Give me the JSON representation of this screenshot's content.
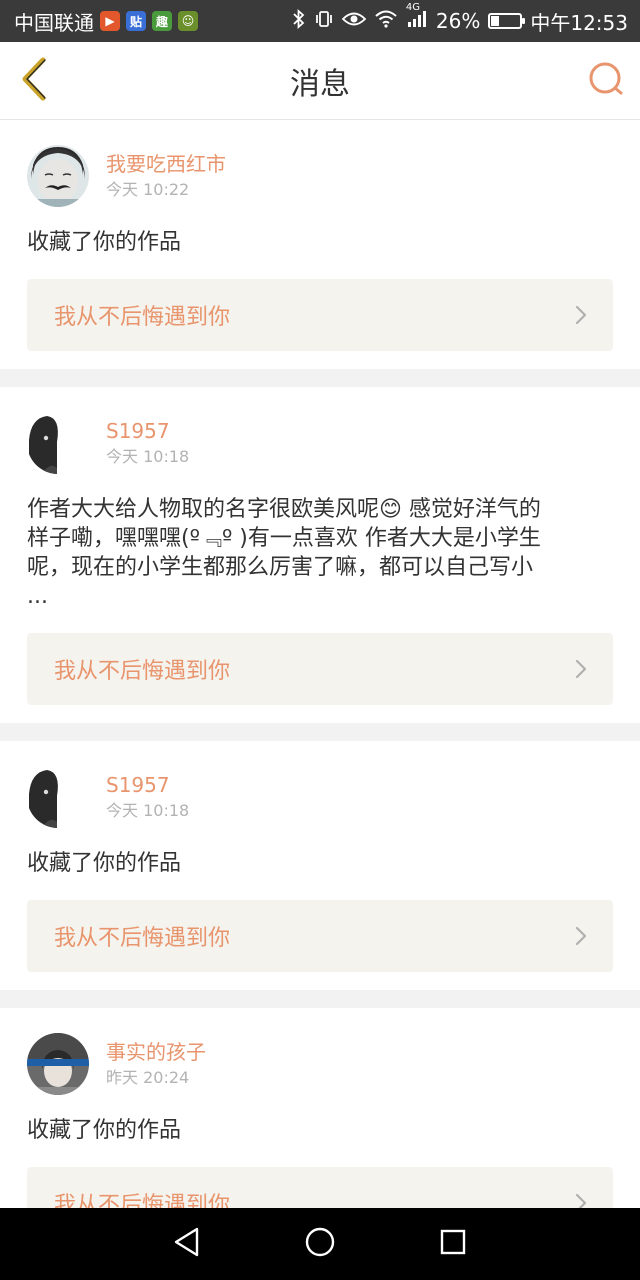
{
  "status_bar": {
    "carrier": "中国联通",
    "battery_percent": "26%",
    "time": "中午12:53",
    "network": "4G",
    "battery_level": 0.26,
    "apps": [
      {
        "icon": "play-app-icon",
        "glyph": "▶",
        "color": "#e2572b"
      },
      {
        "icon": "tieba-app-icon",
        "glyph": "贴",
        "color": "#3b6fd8"
      },
      {
        "icon": "reading-app-icon",
        "glyph": "趣",
        "color": "#4a9b3c"
      },
      {
        "icon": "assistant-app-icon",
        "glyph": "☺",
        "color": "#6b8f2a"
      }
    ]
  },
  "header": {
    "title": "消息",
    "back_icon": "chevron-left-icon",
    "search_icon": "search-icon",
    "accent_color": "#e8956d"
  },
  "messages": [
    {
      "username": "我要吃西红市",
      "time": "今天 10:22",
      "text": "收藏了你的作品",
      "work_title": "我从不后悔遇到你",
      "avatar": "avatar-mustache"
    },
    {
      "username": "S1957",
      "time": "今天 10:18",
      "text": "作者大大给人物取的名字很欧美风呢😊 感觉好洋气的\n样子嘞，嘿嘿嘿(º﹃º )有一点喜欢 作者大大是小学生\n呢，现在的小学生都那么厉害了嘛，都可以自己写小\n...",
      "work_title": "我从不后悔遇到你",
      "avatar": "avatar-dark"
    },
    {
      "username": "S1957",
      "time": "今天 10:18",
      "text": "收藏了你的作品",
      "work_title": "我从不后悔遇到你",
      "avatar": "avatar-dark"
    },
    {
      "username": "事实的孩子",
      "time": "昨天 20:24",
      "text": "收藏了你的作品",
      "work_title": "我从不后悔遇到你",
      "avatar": "avatar-photo"
    }
  ],
  "nav_bar": {
    "back": "nav-back-icon",
    "home": "nav-home-icon",
    "recents": "nav-recents-icon"
  }
}
